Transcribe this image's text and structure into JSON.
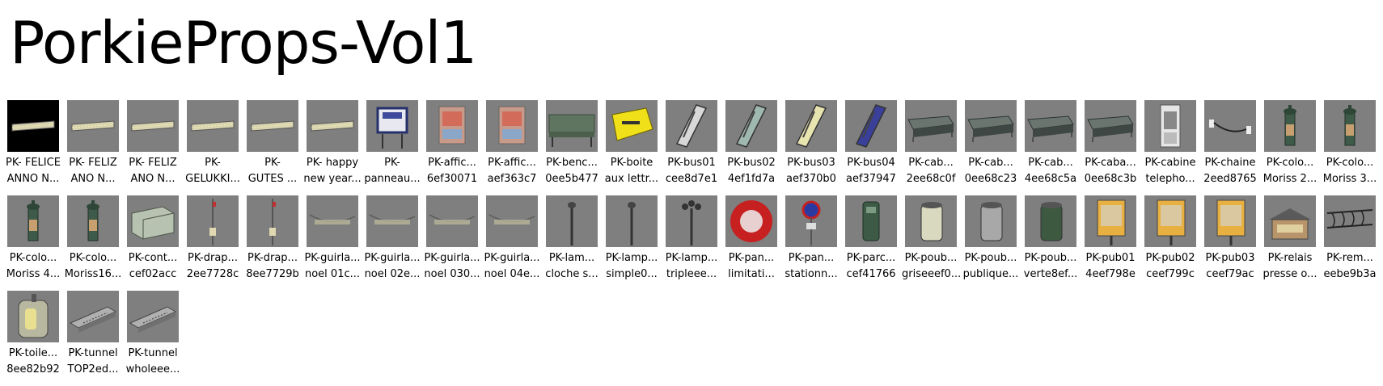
{
  "title": "PorkieProps-Vol1",
  "items": [
    {
      "l1": "PK- FELICE",
      "l2": "ANNO N...",
      "icon": "banner-icon",
      "dark": true
    },
    {
      "l1": "PK- FELIZ",
      "l2": "ANO N...",
      "icon": "banner-icon"
    },
    {
      "l1": "PK- FELIZ",
      "l2": "ANO N...",
      "icon": "banner-icon"
    },
    {
      "l1": "PK-",
      "l2": "GELUKKI...",
      "icon": "banner-icon"
    },
    {
      "l1": "PK-",
      "l2": "GUTES ...",
      "icon": "banner-icon"
    },
    {
      "l1": "PK- happy",
      "l2": "new year...",
      "icon": "banner-icon"
    },
    {
      "l1": "PK-",
      "l2": "panneau...",
      "icon": "sign-board-icon"
    },
    {
      "l1": "PK-affic...",
      "l2": "6ef30071",
      "icon": "poster-icon"
    },
    {
      "l1": "PK-affic...",
      "l2": "aef363c7",
      "icon": "poster-icon"
    },
    {
      "l1": "PK-benc...",
      "l2": "0ee5b477",
      "icon": "bench-icon"
    },
    {
      "l1": "PK-boite",
      "l2": "aux lettr...",
      "icon": "mailbox-icon"
    },
    {
      "l1": "PK-bus01",
      "l2": "cee8d7e1",
      "icon": "bus-icon",
      "color": "#d8d8d8"
    },
    {
      "l1": "PK-bus02",
      "l2": "4ef1fd7a",
      "icon": "bus-icon",
      "color": "#9fb8b0"
    },
    {
      "l1": "PK-bus03",
      "l2": "aef370b0",
      "icon": "bus-icon",
      "color": "#e8e4b0"
    },
    {
      "l1": "PK-bus04",
      "l2": "aef37947",
      "icon": "bus-icon",
      "color": "#3a3f9a"
    },
    {
      "l1": "PK-cab...",
      "l2": "2ee68c0f",
      "icon": "shelter-icon"
    },
    {
      "l1": "PK-cab...",
      "l2": "0ee68c23",
      "icon": "shelter-icon"
    },
    {
      "l1": "PK-cab...",
      "l2": "4ee68c5a",
      "icon": "shelter-icon"
    },
    {
      "l1": "PK-caba...",
      "l2": "0ee68c3b",
      "icon": "shelter-icon"
    },
    {
      "l1": "PK-cabine",
      "l2": "telepho...",
      "icon": "phone-booth-icon"
    },
    {
      "l1": "PK-chaine",
      "l2": "2eed8765",
      "icon": "chain-icon"
    },
    {
      "l1": "PK-colo...",
      "l2": "Moriss 2...",
      "icon": "morris-column-icon"
    },
    {
      "l1": "PK-colo...",
      "l2": "Moriss 3...",
      "icon": "morris-column-icon"
    },
    {
      "l1": "PK-colo...",
      "l2": "Moriss 4...",
      "icon": "morris-column-icon"
    },
    {
      "l1": "PK-colo...",
      "l2": "Moriss16...",
      "icon": "morris-column-icon"
    },
    {
      "l1": "PK-cont...",
      "l2": "cef02acc",
      "icon": "container-icon"
    },
    {
      "l1": "PK-drap...",
      "l2": "2ee7728c",
      "icon": "flag-pole-icon"
    },
    {
      "l1": "PK-drap...",
      "l2": "8ee7729b",
      "icon": "flag-pole-icon"
    },
    {
      "l1": "PK-guirla...",
      "l2": "noel 01c...",
      "icon": "garland-icon"
    },
    {
      "l1": "PK-guirla...",
      "l2": "noel 02e...",
      "icon": "garland-icon"
    },
    {
      "l1": "PK-guirla...",
      "l2": "noel 030...",
      "icon": "garland-icon"
    },
    {
      "l1": "PK-guirla...",
      "l2": "noel 04e...",
      "icon": "garland-icon"
    },
    {
      "l1": "PK-lam...",
      "l2": "cloche s...",
      "icon": "street-lamp-icon"
    },
    {
      "l1": "PK-lamp...",
      "l2": "simple0...",
      "icon": "street-lamp-icon"
    },
    {
      "l1": "PK-lamp...",
      "l2": "tripleee...",
      "icon": "triple-lamp-icon"
    },
    {
      "l1": "PK-pan...",
      "l2": "limitati...",
      "icon": "speed-sign-icon"
    },
    {
      "l1": "PK-pan...",
      "l2": "stationn...",
      "icon": "parking-sign-icon"
    },
    {
      "l1": "PK-parc...",
      "l2": "cef41766",
      "icon": "parking-meter-icon"
    },
    {
      "l1": "PK-poub...",
      "l2": "griseeef0...",
      "icon": "trash-bin-icon",
      "color": "#d9d9c0"
    },
    {
      "l1": "PK-poub...",
      "l2": "publique...",
      "icon": "trash-bin-icon",
      "color": "#a8a8a8"
    },
    {
      "l1": "PK-poub...",
      "l2": "verte8ef...",
      "icon": "trash-bin-icon",
      "color": "#3d5a40"
    },
    {
      "l1": "PK-pub01",
      "l2": "4eef798e",
      "icon": "billboard-icon"
    },
    {
      "l1": "PK-pub02",
      "l2": "ceef799c",
      "icon": "billboard-icon"
    },
    {
      "l1": "PK-pub03",
      "l2": "ceef79ac",
      "icon": "billboard-icon"
    },
    {
      "l1": "PK-relais",
      "l2": "presse o...",
      "icon": "kiosk-icon"
    },
    {
      "l1": "PK-rem...",
      "l2": "eebe9b3a",
      "icon": "fence-icon"
    },
    {
      "l1": "PK-toile...",
      "l2": "8ee82b92",
      "icon": "toilet-icon"
    },
    {
      "l1": "PK-tunnel",
      "l2": "TOP2ed...",
      "icon": "tunnel-icon"
    },
    {
      "l1": "PK-tunnel",
      "l2": "wholeee...",
      "icon": "tunnel-icon"
    }
  ]
}
